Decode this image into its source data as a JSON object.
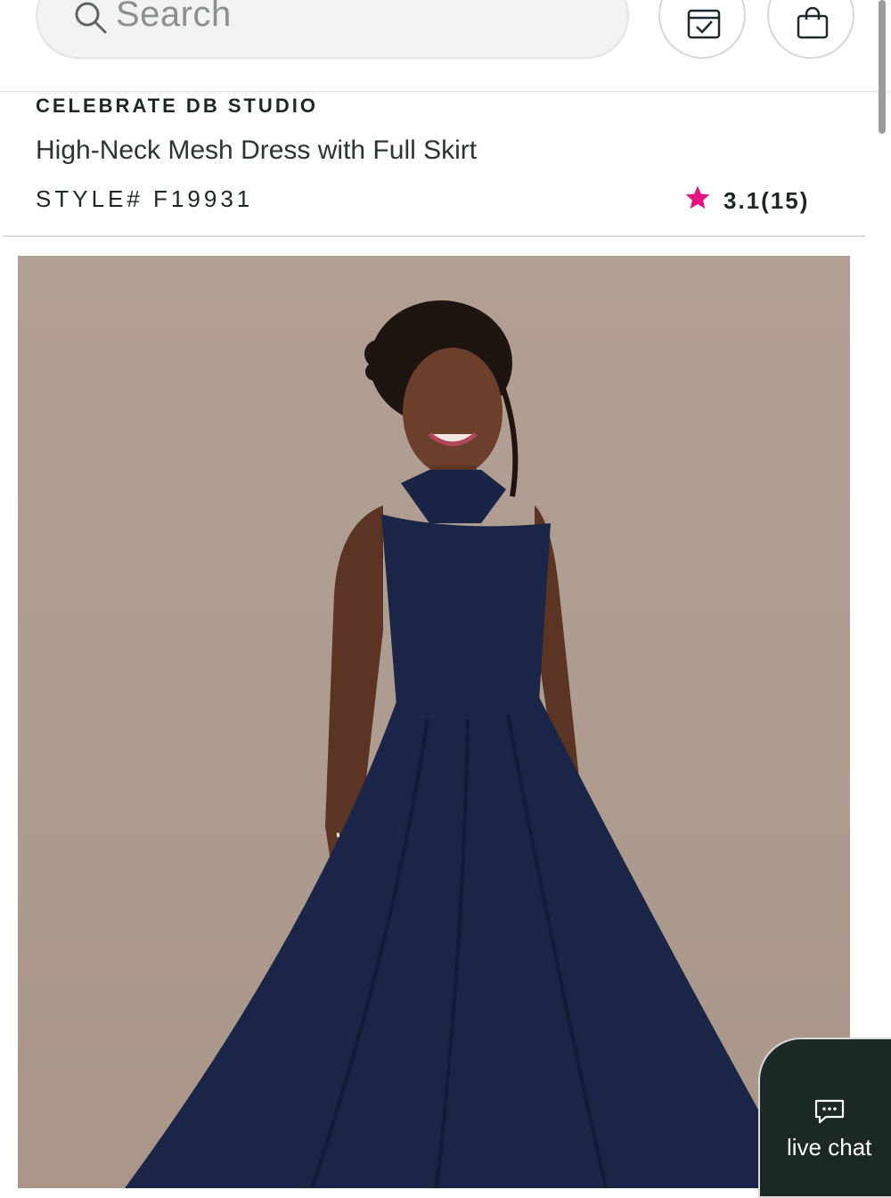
{
  "header": {
    "search_placeholder": "Search",
    "calendar_icon": "calendar-check-icon",
    "bag_icon": "shopping-bag-icon"
  },
  "product": {
    "brand": "CELEBRATE DB STUDIO",
    "title": "High-Neck Mesh Dress with Full Skirt",
    "style": "STYLE# F19931",
    "rating": "3.1(15)",
    "star_color": "#e4137f",
    "image_alt": "Model wearing navy high-neck halter mesh dress with full skirt"
  },
  "chat": {
    "label": "live chat",
    "icon": "chat-bubble-icon"
  }
}
